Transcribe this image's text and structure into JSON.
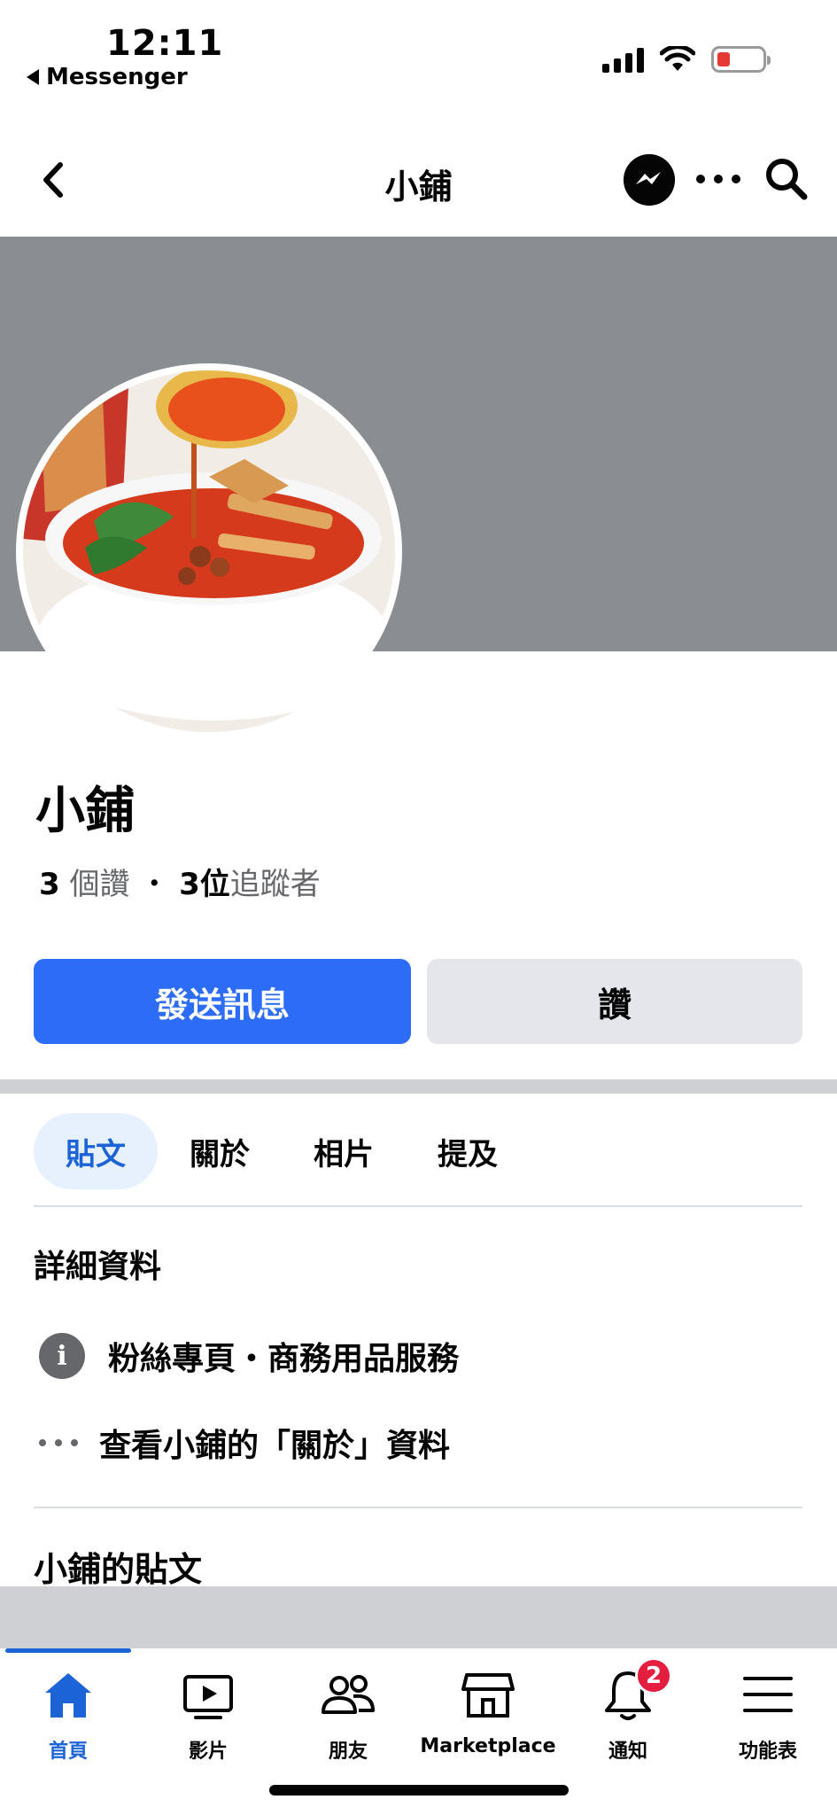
{
  "status_bar": {
    "time": "12:11",
    "back_app": "Messenger"
  },
  "nav": {
    "title": "小鋪"
  },
  "profile": {
    "name": "小鋪",
    "likes_count": "3",
    "likes_label": "個讚",
    "separator": "・",
    "followers_count": "3",
    "followers_unit": "位",
    "followers_label": "追蹤者"
  },
  "actions": {
    "send_message": "發送訊息",
    "like": "讚"
  },
  "tabs": [
    {
      "label": "貼文",
      "active": true
    },
    {
      "label": "關於",
      "active": false
    },
    {
      "label": "相片",
      "active": false
    },
    {
      "label": "提及",
      "active": false
    }
  ],
  "details": {
    "title": "詳細資料",
    "category": "粉絲專頁・商務用品服務",
    "see_about": "查看小鋪的「關於」資料"
  },
  "posts": {
    "title": "小鋪的貼文"
  },
  "bottom_tabs": [
    {
      "label": "首頁",
      "icon": "home-icon",
      "active": true
    },
    {
      "label": "影片",
      "icon": "video-icon",
      "active": false
    },
    {
      "label": "朋友",
      "icon": "friends-icon",
      "active": false
    },
    {
      "label": "Marketplace",
      "icon": "marketplace-icon",
      "active": false
    },
    {
      "label": "通知",
      "icon": "bell-icon",
      "active": false,
      "badge": "2"
    },
    {
      "label": "功能表",
      "icon": "menu-icon",
      "active": false
    }
  ],
  "colors": {
    "accent": "#2d6cf6",
    "active_tab": "#1b63d6",
    "cover": "#8a8d91",
    "badge": "#e41e3f"
  }
}
